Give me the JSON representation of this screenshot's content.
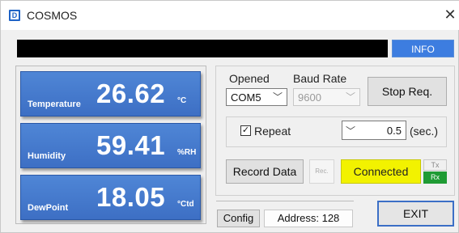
{
  "window": {
    "title": "COSMOS",
    "icon": "D"
  },
  "info_button": "INFO",
  "readouts": [
    {
      "label": "Temperature",
      "value": "26.62",
      "unit": "°C"
    },
    {
      "label": "Humidity",
      "value": "59.41",
      "unit": "%RH"
    },
    {
      "label": "DewPoint",
      "value": "18.05",
      "unit": "°Ctd"
    }
  ],
  "port": {
    "label": "Opened",
    "value": "COM5"
  },
  "baud": {
    "label": "Baud Rate",
    "value": "9600"
  },
  "stop_button": "Stop Req.",
  "repeat": {
    "label": "Repeat",
    "checked": "☑",
    "interval": "0.5",
    "unit": "(sec.)"
  },
  "record_button": "Record Data",
  "rec_indicator": "Rec.",
  "status": {
    "text": "Connected",
    "color": "#f2f200"
  },
  "tx_label": "Tx",
  "rx_label": "Rx",
  "config_button": "Config",
  "address": "Address: 128",
  "exit_button": "EXIT",
  "colors": {
    "readout_bg": "#4a80d2",
    "info_bg": "#3d7de0",
    "rx_bg": "#1f9b34",
    "exit_border": "#3b6fc6"
  }
}
